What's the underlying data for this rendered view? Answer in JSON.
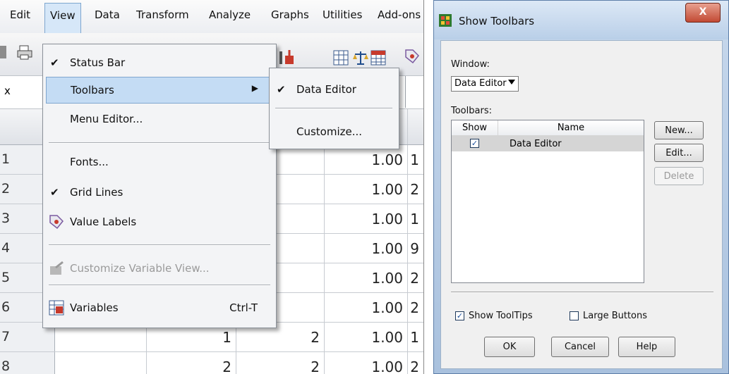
{
  "menubar": {
    "items": [
      "Edit",
      "View",
      "Data",
      "Transform",
      "Analyze",
      "Graphs",
      "Utilities",
      "Add-ons"
    ]
  },
  "namebox": {
    "text": "x"
  },
  "grid": {
    "rows": [
      {
        "num": "1",
        "c2": "",
        "c3": "",
        "c4": "1.00",
        "c5": "1"
      },
      {
        "num": "2",
        "c2": "",
        "c3": "",
        "c4": "1.00",
        "c5": "2"
      },
      {
        "num": "3",
        "c2": "",
        "c3": "",
        "c4": "1.00",
        "c5": "1"
      },
      {
        "num": "4",
        "c2": "",
        "c3": "",
        "c4": "1.00",
        "c5": "9"
      },
      {
        "num": "5",
        "c2": "",
        "c3": "",
        "c4": "1.00",
        "c5": "2"
      },
      {
        "num": "6",
        "c2": "",
        "c3": "",
        "c4": "1.00",
        "c5": "2"
      },
      {
        "num": "7",
        "c2": "1",
        "c3": "2",
        "c4": "1.00",
        "c5": "1"
      },
      {
        "num": "8",
        "c2": "2",
        "c3": "2",
        "c4": "1.00",
        "c5": "2"
      }
    ]
  },
  "view_menu": {
    "status_bar": "Status Bar",
    "toolbars": "Toolbars",
    "menu_editor": "Menu Editor...",
    "fonts": "Fonts...",
    "grid_lines": "Grid Lines",
    "value_labels": "Value Labels",
    "customize_variable_view": "Customize Variable View...",
    "variables": "Variables",
    "variables_shortcut": "Ctrl-T"
  },
  "toolbars_submenu": {
    "data_editor": "Data Editor",
    "customize": "Customize..."
  },
  "dialog": {
    "title": "Show Toolbars",
    "close_glyph": "X",
    "window_label": "Window:",
    "window_value": "Data Editor",
    "toolbars_label": "Toolbars:",
    "col_show": "Show",
    "col_name": "Name",
    "row_name": "Data Editor",
    "row_checked": true,
    "new_button": "New...",
    "edit_button": "Edit...",
    "delete_button": "Delete",
    "show_tooltips": "Show ToolTips",
    "show_tooltips_checked": true,
    "large_buttons": "Large Buttons",
    "large_buttons_checked": false,
    "ok": "OK",
    "cancel": "Cancel",
    "help": "Help"
  },
  "colors": {
    "menu_highlight": "#c4dcf4",
    "dialog_frame": "#a9c1de",
    "close_button": "#c24a34"
  }
}
